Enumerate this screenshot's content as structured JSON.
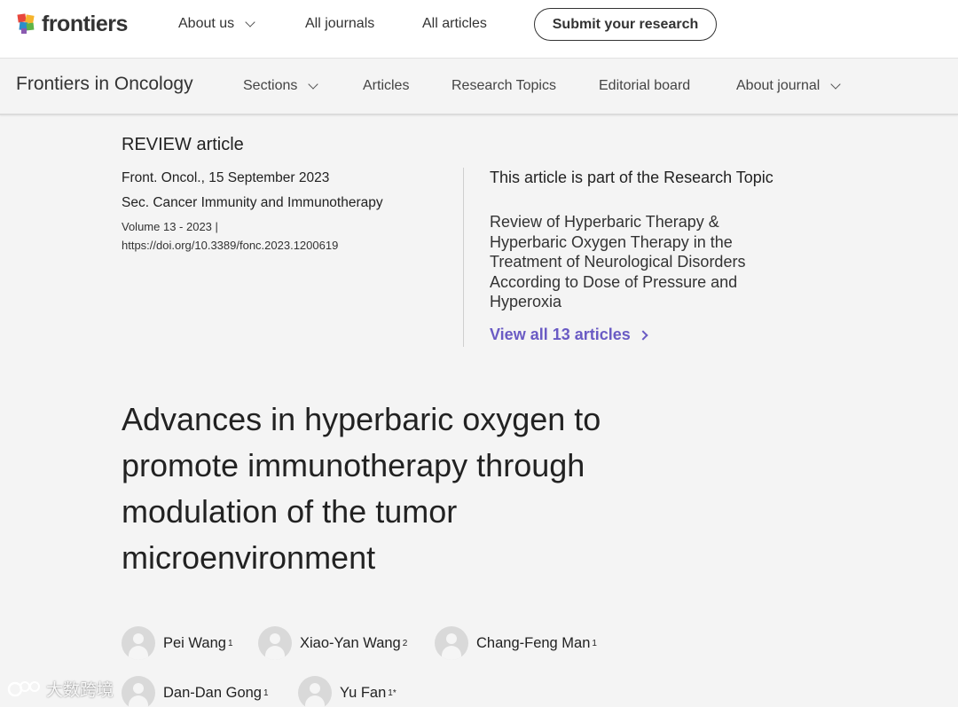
{
  "topbar": {
    "logo_text": "frontiers",
    "nav": [
      {
        "label": "About us"
      },
      {
        "label": "All journals"
      },
      {
        "label": "All articles"
      }
    ],
    "submit_label": "Submit your research"
  },
  "journal_bar": {
    "title": "Frontiers in Oncology",
    "nav": [
      {
        "label": "Sections"
      },
      {
        "label": "Articles"
      },
      {
        "label": "Research Topics"
      },
      {
        "label": "Editorial board"
      },
      {
        "label": "About journal"
      }
    ]
  },
  "article": {
    "type": "REVIEW article",
    "journal_date": "Front. Oncol., 15 September 2023",
    "section": "Sec. Cancer Immunity and Immunotherapy",
    "volume": "Volume 13 - 2023 |",
    "doi": "https://doi.org/10.3389/fonc.2023.1200619",
    "title": "Advances in hyperbaric oxygen to promote immunotherapy through modulation of the tumor microenvironment"
  },
  "research_topic": {
    "heading": "This article is part of the Research Topic",
    "name": "Review of Hyperbaric Therapy & Hyperbaric Oxygen Therapy in the Treatment of Neurological Disorders According to Dose of Pressure and Hyperoxia",
    "view_all": "View all 13 articles"
  },
  "authors": [
    {
      "name": "Pei Wang",
      "aff": "1"
    },
    {
      "name": "Xiao-Yan Wang",
      "aff": "2"
    },
    {
      "name": "Chang-Feng Man",
      "aff": "1"
    },
    {
      "name": "Dan-Dan Gong",
      "aff": "1"
    },
    {
      "name": "Yu Fan",
      "aff": "1*"
    }
  ],
  "watermark": "大数跨境",
  "colors": {
    "accent_link": "#6a5bc4",
    "background": "#f4f4f4"
  }
}
